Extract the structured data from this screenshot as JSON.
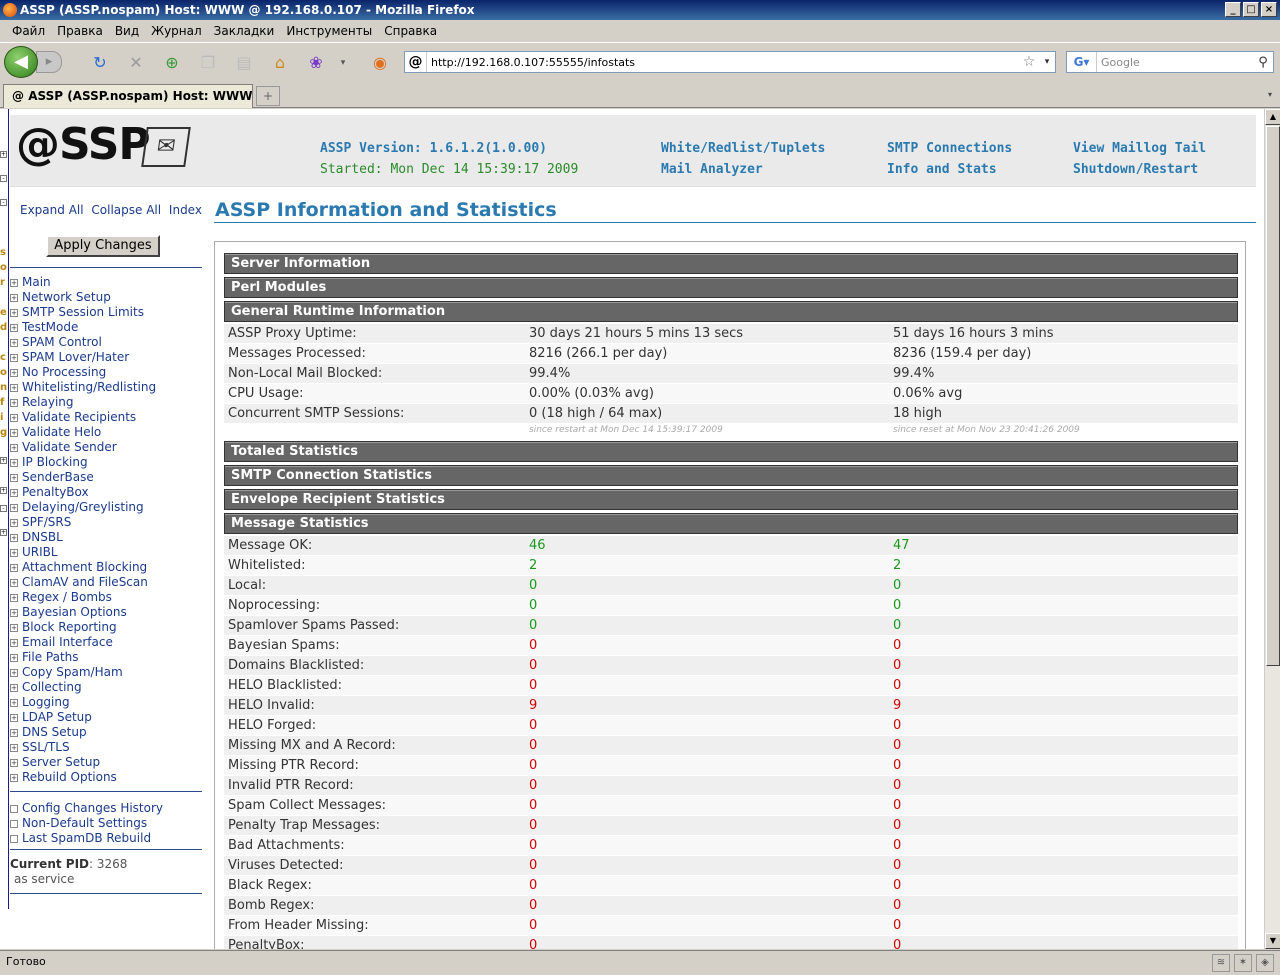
{
  "window": {
    "title": "ASSP (ASSP.nospam) Host: WWW @ 192.168.0.107 - Mozilla Firefox",
    "min": "_",
    "max": "□",
    "close": "×"
  },
  "menu": [
    "Файл",
    "Правка",
    "Вид",
    "Журнал",
    "Закладки",
    "Инструменты",
    "Справка"
  ],
  "urlbar": {
    "url": "http://192.168.0.107:55555/infostats"
  },
  "search": {
    "placeholder": "Google"
  },
  "tab": {
    "label": "ASSP (ASSP.nospam) Host: WWW @ ..."
  },
  "status": {
    "text": "Готово"
  },
  "header": {
    "logo": "@SSP",
    "version": "ASSP Version: 1.6.1.2(1.0.00)",
    "started": "Started: Mon Dec 14 15:39:17 2009",
    "links": {
      "white_redlist": "White/Redlist/Tuplets",
      "mail_analyzer": "Mail Analyzer",
      "smtp_connections": "SMTP Connections",
      "info_stats": "Info and Stats",
      "maillog_tail": "View Maillog Tail",
      "shutdown": "Shutdown/Restart"
    }
  },
  "leftnav": {
    "expand_all": "Expand All",
    "collapse_all": "Collapse All",
    "index": "Index",
    "apply": "Apply Changes",
    "items": [
      "Main",
      "Network Setup",
      "SMTP Session Limits",
      "TestMode",
      "SPAM Control",
      "SPAM Lover/Hater",
      "No Processing",
      "Whitelisting/Redlisting",
      "Relaying",
      "Validate Recipients",
      "Validate Helo",
      "Validate Sender",
      "IP Blocking",
      "SenderBase",
      "PenaltyBox",
      "Delaying/Greylisting",
      "SPF/SRS",
      "DNSBL",
      "URIBL",
      "Attachment Blocking",
      "ClamAV and FileScan",
      "Regex / Bombs",
      "Bayesian Options",
      "Block Reporting",
      "Email Interface",
      "File Paths",
      "Copy Spam/Ham",
      "Collecting",
      "Logging",
      "LDAP Setup",
      "DNS Setup",
      "SSL/TLS",
      "Server Setup",
      "Rebuild Options"
    ],
    "extra": [
      "Config Changes History",
      "Non-Default Settings",
      "Last SpamDB Rebuild"
    ],
    "pid_label": "Current PID",
    "pid_value": ": 3268",
    "pid_mode": "as service",
    "strip_chars": [
      "s",
      "o",
      "r",
      "e",
      "d",
      "c",
      "o",
      "n",
      "f",
      "i",
      "g"
    ]
  },
  "main": {
    "title": "ASSP Information and Statistics",
    "sections": {
      "server": "Server Information",
      "perl": "Perl Modules",
      "runtime": "General Runtime Information",
      "totaled": "Totaled Statistics",
      "smtp": "SMTP Connection Statistics",
      "envelope": "Envelope Recipient Statistics",
      "message": "Message Statistics"
    },
    "runtime_rows": [
      [
        "ASSP Proxy Uptime:",
        "30 days 21 hours 5 mins 13 secs",
        "51 days 16 hours 3 mins"
      ],
      [
        "Messages Processed:",
        "8216 (266.1 per day)",
        "8236 (159.4 per day)"
      ],
      [
        "Non-Local Mail Blocked:",
        "99.4%",
        "99.4%"
      ],
      [
        "CPU Usage:",
        "0.00% (0.03% avg)",
        "0.06% avg"
      ],
      [
        "Concurrent SMTP Sessions:",
        "0 (18 high / 64 max)",
        "18 high"
      ]
    ],
    "runtime_note": [
      "since restart at Mon Dec 14 15:39:17 2009",
      "since reset at Mon Nov 23 20:41:26 2009"
    ],
    "message_rows": [
      [
        "Message OK:",
        "46",
        "47",
        "green"
      ],
      [
        "Whitelisted:",
        "2",
        "2",
        "green"
      ],
      [
        "Local:",
        "0",
        "0",
        "green"
      ],
      [
        "Noprocessing:",
        "0",
        "0",
        "green"
      ],
      [
        "Spamlover Spams Passed:",
        "0",
        "0",
        "green"
      ],
      [
        "Bayesian Spams:",
        "0",
        "0",
        "red"
      ],
      [
        "Domains Blacklisted:",
        "0",
        "0",
        "red"
      ],
      [
        "HELO Blacklisted:",
        "0",
        "0",
        "red"
      ],
      [
        "HELO Invalid:",
        "9",
        "9",
        "red"
      ],
      [
        "HELO Forged:",
        "0",
        "0",
        "red"
      ],
      [
        "Missing MX and A Record:",
        "0",
        "0",
        "red"
      ],
      [
        "Missing PTR Record:",
        "0",
        "0",
        "red"
      ],
      [
        "Invalid PTR Record:",
        "0",
        "0",
        "red"
      ],
      [
        "Spam Collect Messages:",
        "0",
        "0",
        "red"
      ],
      [
        "Penalty Trap Messages:",
        "0",
        "0",
        "red"
      ],
      [
        "Bad Attachments:",
        "0",
        "0",
        "red"
      ],
      [
        "Viruses Detected:",
        "0",
        "0",
        "red"
      ],
      [
        "Black Regex:",
        "0",
        "0",
        "red"
      ],
      [
        "Bomb Regex:",
        "0",
        "0",
        "red"
      ],
      [
        "From Header Missing:",
        "0",
        "0",
        "red"
      ],
      [
        "PenaltyBox:",
        "0",
        "0",
        "red"
      ]
    ]
  }
}
